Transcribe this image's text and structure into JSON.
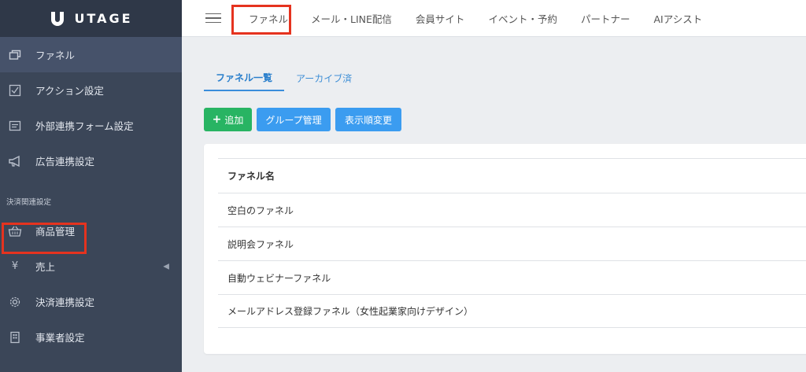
{
  "brand": {
    "name": "UTAGE"
  },
  "sidebar": {
    "items": [
      {
        "label": "ファネル",
        "icon": "funnel-pages-icon"
      },
      {
        "label": "アクション設定",
        "icon": "checklist-icon"
      },
      {
        "label": "外部連携フォーム設定",
        "icon": "form-icon"
      },
      {
        "label": "広告連携設定",
        "icon": "megaphone-icon"
      }
    ],
    "section_label": "決済関連設定",
    "payment_items": [
      {
        "label": "商品管理",
        "icon": "basket-icon"
      },
      {
        "label": "売上",
        "icon": "yen-icon"
      },
      {
        "label": "決済連携設定",
        "icon": "gear-icon"
      },
      {
        "label": "事業者設定",
        "icon": "building-icon"
      }
    ]
  },
  "topbar": {
    "tabs": [
      "ファネル",
      "メール・LINE配信",
      "会員サイト",
      "イベント・予約",
      "パートナー",
      "AIアシスト"
    ]
  },
  "subtabs": [
    "ファネル一覧",
    "アーカイブ済"
  ],
  "buttons": {
    "add": "追加",
    "group": "グループ管理",
    "order": "表示順変更"
  },
  "table": {
    "header": "ファネル名",
    "rows": [
      "空白のファネル",
      "説明会ファネル",
      "自動ウェビナーファネル",
      "メールアドレス登録ファネル（女性起業家向けデザイン）"
    ]
  },
  "colors": {
    "highlight": "#e5331f",
    "sidebar": "#3b4658",
    "accent": "#3b9cf0",
    "add": "#28b463"
  }
}
